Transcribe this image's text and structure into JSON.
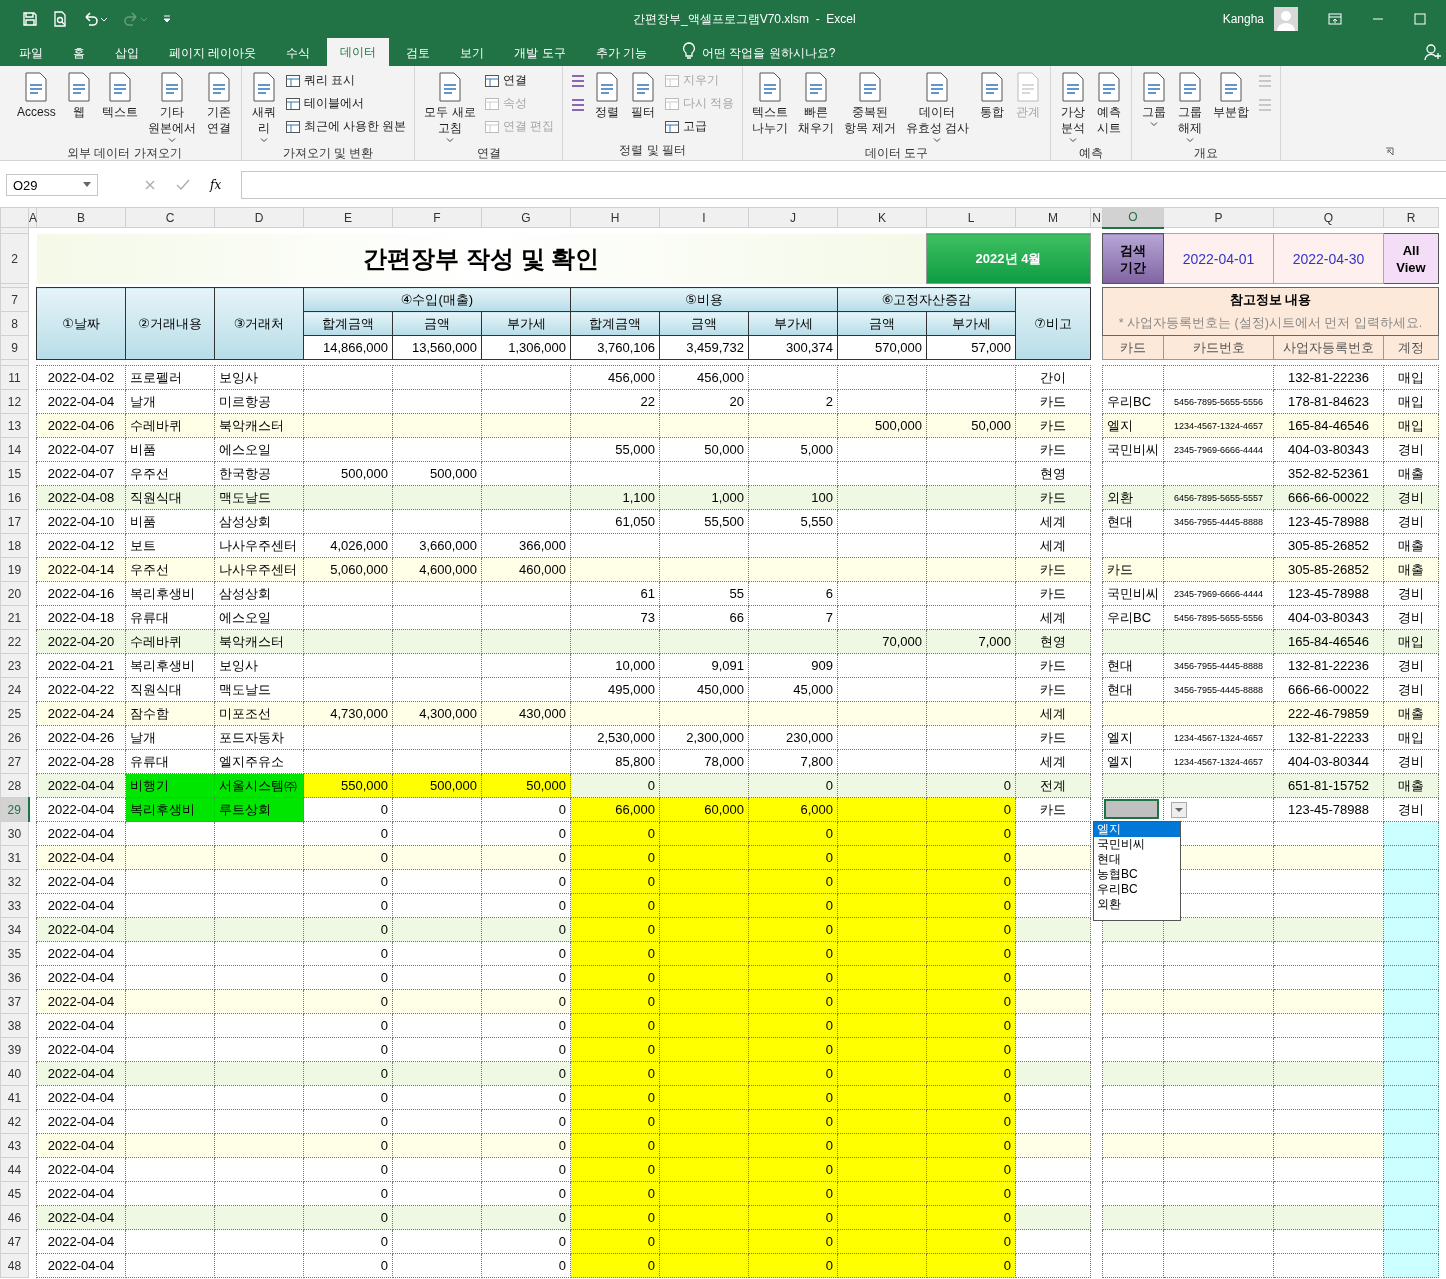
{
  "title_bar": {
    "title": "간편장부_액셀프로그램V70.xlsm  -  Excel",
    "user": "Kangha"
  },
  "tabs": [
    {
      "label": "파일",
      "selected": false
    },
    {
      "label": "홈",
      "selected": false
    },
    {
      "label": "삽입",
      "selected": false
    },
    {
      "label": "페이지 레이아웃",
      "selected": false
    },
    {
      "label": "수식",
      "selected": false
    },
    {
      "label": "데이터",
      "selected": true
    },
    {
      "label": "검토",
      "selected": false
    },
    {
      "label": "보기",
      "selected": false
    },
    {
      "label": "개발 도구",
      "selected": false
    },
    {
      "label": "추가 기능",
      "selected": false
    }
  ],
  "tell_me": {
    "placeholder": "어떤 작업을 원하시나요?"
  },
  "ribbon": [
    {
      "label": "외부 데이터 가져오기",
      "items": [
        {
          "kind": "large",
          "lines": [
            "Access"
          ],
          "menu": false,
          "disabled": false
        },
        {
          "kind": "large",
          "lines": [
            "웹"
          ],
          "menu": false,
          "disabled": false
        },
        {
          "kind": "large",
          "lines": [
            "텍스트"
          ],
          "menu": false,
          "disabled": false
        },
        {
          "kind": "large",
          "lines": [
            "기타",
            "원본에서"
          ],
          "menu": true,
          "disabled": false
        },
        {
          "kind": "large",
          "lines": [
            "기존",
            "연결"
          ],
          "menu": false,
          "disabled": false
        }
      ]
    },
    {
      "label": "가져오기 및 변환",
      "items": [
        {
          "kind": "large",
          "lines": [
            "새쿼",
            "리"
          ],
          "menu": true,
          "disabled": false
        },
        {
          "kind": "stack",
          "items": [
            {
              "label": "쿼리 표시",
              "disabled": false
            },
            {
              "label": "테이블에서",
              "disabled": false
            },
            {
              "label": "최근에 사용한 원본",
              "disabled": false
            }
          ]
        }
      ]
    },
    {
      "label": "연결",
      "items": [
        {
          "kind": "large",
          "lines": [
            "모두 새로",
            "고침"
          ],
          "menu": true,
          "disabled": false
        },
        {
          "kind": "stack",
          "items": [
            {
              "label": "연결",
              "disabled": false
            },
            {
              "label": "속성",
              "disabled": true
            },
            {
              "label": "연결 편집",
              "disabled": true
            }
          ]
        }
      ]
    },
    {
      "label": "정렬 및 필터",
      "items": [
        {
          "kind": "stack",
          "items": [
            {
              "disabled": false
            },
            {
              "disabled": false
            }
          ]
        },
        {
          "kind": "large",
          "lines": [
            "정렬"
          ],
          "menu": false,
          "disabled": false
        },
        {
          "kind": "large",
          "lines": [
            "필터"
          ],
          "menu": false,
          "disabled": false
        },
        {
          "kind": "stack",
          "items": [
            {
              "label": "지우기",
              "disabled": true
            },
            {
              "label": "다시 적용",
              "disabled": true
            },
            {
              "label": "고급",
              "disabled": false
            }
          ]
        }
      ]
    },
    {
      "label": "데이터 도구",
      "items": [
        {
          "kind": "large",
          "lines": [
            "텍스트",
            "나누기"
          ],
          "menu": false,
          "disabled": false
        },
        {
          "kind": "large",
          "lines": [
            "빠른",
            "채우기"
          ],
          "menu": false,
          "disabled": false
        },
        {
          "kind": "large",
          "lines": [
            "중복된",
            "항목 제거"
          ],
          "menu": false,
          "disabled": false
        },
        {
          "kind": "large",
          "lines": [
            "데이터",
            "유효성 검사"
          ],
          "menu": true,
          "disabled": false
        },
        {
          "kind": "large",
          "lines": [
            "통합"
          ],
          "menu": false,
          "disabled": false
        },
        {
          "kind": "large",
          "lines": [
            "관계"
          ],
          "menu": false,
          "disabled": true
        }
      ]
    },
    {
      "label": "예측",
      "items": [
        {
          "kind": "large",
          "lines": [
            "가상",
            "분석"
          ],
          "menu": true,
          "disabled": false
        },
        {
          "kind": "large",
          "lines": [
            "예측",
            "시트"
          ],
          "menu": false,
          "disabled": false
        }
      ]
    },
    {
      "label": "개요",
      "items": [
        {
          "kind": "large",
          "lines": [
            "그룹"
          ],
          "menu": true,
          "disabled": false
        },
        {
          "kind": "large",
          "lines": [
            "그룹",
            "해제"
          ],
          "menu": true,
          "disabled": false
        },
        {
          "kind": "large",
          "lines": [
            "부분합"
          ],
          "menu": false,
          "disabled": false
        },
        {
          "kind": "stack",
          "items": [
            {
              "disabled": true
            },
            {
              "disabled": true
            }
          ]
        }
      ]
    }
  ],
  "formula_bar": {
    "name_box": "O29",
    "fx": "fx"
  },
  "columns": [
    {
      "label": "A",
      "selected": false
    },
    {
      "label": "B",
      "selected": false
    },
    {
      "label": "C",
      "selected": false
    },
    {
      "label": "D",
      "selected": false
    },
    {
      "label": "E",
      "selected": false
    },
    {
      "label": "F",
      "selected": false
    },
    {
      "label": "G",
      "selected": false
    },
    {
      "label": "H",
      "selected": false
    },
    {
      "label": "I",
      "selected": false
    },
    {
      "label": "J",
      "selected": false
    },
    {
      "label": "K",
      "selected": false
    },
    {
      "label": "L",
      "selected": false
    },
    {
      "label": "M",
      "selected": false
    },
    {
      "label": "N",
      "selected": false
    },
    {
      "label": "O",
      "selected": true
    },
    {
      "label": "P",
      "selected": false
    },
    {
      "label": "Q",
      "selected": false
    },
    {
      "label": "R",
      "selected": false
    }
  ],
  "header_rows": [
    "2",
    "7",
    "8",
    "9"
  ],
  "header": {
    "title": "간편장부 작성 및 확인",
    "month": "2022년 4월",
    "search_label": [
      "검색",
      "기간"
    ],
    "start": "2022-04-01",
    "end": "2022-04-30",
    "all_view": [
      "All",
      "View"
    ],
    "col_date": "①날짜",
    "col_desc": "②거래내용",
    "col_vendor": "③거래처",
    "income": {
      "label": "④수입(매출)",
      "sub": [
        "합계금액",
        "금액",
        "부가세"
      ],
      "totals": [
        "14,866,000",
        "13,560,000",
        "1,306,000"
      ]
    },
    "expense": {
      "label": "⑤비용",
      "sub": [
        "합계금액",
        "금액",
        "부가세"
      ],
      "totals": [
        "3,760,106",
        "3,459,732",
        "300,374"
      ]
    },
    "assets": {
      "label": "⑥고정자산증감",
      "sub": [
        "금액",
        "부가세"
      ],
      "totals": [
        "570,000",
        "57,000"
      ]
    },
    "note": "⑦비고",
    "ref_title": "참고정보 내용",
    "ref_note": "* 사업자등록번호는 (설정)시트에서 먼저 입력하세요.",
    "ref_cols": [
      "카드",
      "카드번호",
      "사업자등록번호",
      "계정"
    ]
  },
  "rows": [
    {
      "row": "11",
      "color": "#ffffff",
      "name_fill": false,
      "income_fill": false,
      "expense_fill": false,
      "account_fill": false,
      "selected": false,
      "cells": [
        "2022-04-02",
        "프로펠러",
        "보잉사",
        "",
        "",
        "",
        "456,000",
        "456,000",
        "",
        "",
        "",
        "간이",
        "",
        "",
        "132-81-22236",
        "매입"
      ]
    },
    {
      "row": "12",
      "color": "#ffffff",
      "name_fill": false,
      "income_fill": false,
      "expense_fill": false,
      "account_fill": false,
      "selected": false,
      "cells": [
        "2022-04-04",
        "날개",
        "미르항공",
        "",
        "",
        "",
        "22",
        "20",
        "2",
        "",
        "",
        "카드",
        "우리BC",
        "5456-7895-5655-5556",
        "178-81-84623",
        "매입"
      ]
    },
    {
      "row": "13",
      "color": "#ffffe8",
      "name_fill": false,
      "income_fill": false,
      "expense_fill": false,
      "account_fill": false,
      "selected": false,
      "cells": [
        "2022-04-06",
        "수레바퀴",
        "북악캐스터",
        "",
        "",
        "",
        "",
        "",
        "",
        "500,000",
        "50,000",
        "카드",
        "엘지",
        "1234-4567-1324-4657",
        "165-84-46546",
        "매입"
      ]
    },
    {
      "row": "14",
      "color": "#ffffff",
      "name_fill": false,
      "income_fill": false,
      "expense_fill": false,
      "account_fill": false,
      "selected": false,
      "cells": [
        "2022-04-07",
        "비품",
        "에스오일",
        "",
        "",
        "",
        "55,000",
        "50,000",
        "5,000",
        "",
        "",
        "카드",
        "국민비씨",
        "2345-7969-6666-4444",
        "404-03-80343",
        "경비"
      ]
    },
    {
      "row": "15",
      "color": "#ffffff",
      "name_fill": false,
      "income_fill": false,
      "expense_fill": false,
      "account_fill": false,
      "selected": false,
      "cells": [
        "2022-04-07",
        "우주선",
        "한국항공",
        "500,000",
        "500,000",
        "",
        "",
        "",
        "",
        "",
        "",
        "현영",
        "",
        "",
        "352-82-52361",
        "매출"
      ]
    },
    {
      "row": "16",
      "color": "#eef8e2",
      "name_fill": false,
      "income_fill": false,
      "expense_fill": false,
      "account_fill": false,
      "selected": false,
      "cells": [
        "2022-04-08",
        "직원식대",
        "맥도날드",
        "",
        "",
        "",
        "1,100",
        "1,000",
        "100",
        "",
        "",
        "카드",
        "외환",
        "6456-7895-5655-5557",
        "666-66-00022",
        "경비"
      ]
    },
    {
      "row": "17",
      "color": "#ffffff",
      "name_fill": false,
      "income_fill": false,
      "expense_fill": false,
      "account_fill": false,
      "selected": false,
      "cells": [
        "2022-04-10",
        "비품",
        "삼성상회",
        "",
        "",
        "",
        "61,050",
        "55,500",
        "5,550",
        "",
        "",
        "세계",
        "현대",
        "3456-7955-4445-8888",
        "123-45-78988",
        "경비"
      ]
    },
    {
      "row": "18",
      "color": "#ffffff",
      "name_fill": false,
      "income_fill": false,
      "expense_fill": false,
      "account_fill": false,
      "selected": false,
      "cells": [
        "2022-04-12",
        "보트",
        "나사우주센터",
        "4,026,000",
        "3,660,000",
        "366,000",
        "",
        "",
        "",
        "",
        "",
        "세계",
        "",
        "",
        "305-85-26852",
        "매출"
      ]
    },
    {
      "row": "19",
      "color": "#ffffe8",
      "name_fill": false,
      "income_fill": false,
      "expense_fill": false,
      "account_fill": false,
      "selected": false,
      "cells": [
        "2022-04-14",
        "우주선",
        "나사우주센터",
        "5,060,000",
        "4,600,000",
        "460,000",
        "",
        "",
        "",
        "",
        "",
        "카드",
        "카드",
        "",
        "305-85-26852",
        "매출"
      ]
    },
    {
      "row": "20",
      "color": "#ffffff",
      "name_fill": false,
      "income_fill": false,
      "expense_fill": false,
      "account_fill": false,
      "selected": false,
      "cells": [
        "2022-04-16",
        "복리후생비",
        "삼성상회",
        "",
        "",
        "",
        "61",
        "55",
        "6",
        "",
        "",
        "카드",
        "국민비씨",
        "2345-7969-6666-4444",
        "123-45-78988",
        "경비"
      ]
    },
    {
      "row": "21",
      "color": "#ffffff",
      "name_fill": false,
      "income_fill": false,
      "expense_fill": false,
      "account_fill": false,
      "selected": false,
      "cells": [
        "2022-04-18",
        "유류대",
        "에스오일",
        "",
        "",
        "",
        "73",
        "66",
        "7",
        "",
        "",
        "세계",
        "우리BC",
        "5456-7895-5655-5556",
        "404-03-80343",
        "경비"
      ]
    },
    {
      "row": "22",
      "color": "#eef8e2",
      "name_fill": false,
      "income_fill": false,
      "expense_fill": false,
      "account_fill": false,
      "selected": false,
      "cells": [
        "2022-04-20",
        "수레바퀴",
        "북악캐스터",
        "",
        "",
        "",
        "",
        "",
        "",
        "70,000",
        "7,000",
        "현영",
        "",
        "",
        "165-84-46546",
        "매입"
      ]
    },
    {
      "row": "23",
      "color": "#ffffff",
      "name_fill": false,
      "income_fill": false,
      "expense_fill": false,
      "account_fill": false,
      "selected": false,
      "cells": [
        "2022-04-21",
        "복리후생비",
        "보잉사",
        "",
        "",
        "",
        "10,000",
        "9,091",
        "909",
        "",
        "",
        "카드",
        "현대",
        "3456-7955-4445-8888",
        "132-81-22236",
        "경비"
      ]
    },
    {
      "row": "24",
      "color": "#ffffff",
      "name_fill": false,
      "income_fill": false,
      "expense_fill": false,
      "account_fill": false,
      "selected": false,
      "cells": [
        "2022-04-22",
        "직원식대",
        "맥도날드",
        "",
        "",
        "",
        "495,000",
        "450,000",
        "45,000",
        "",
        "",
        "카드",
        "현대",
        "3456-7955-4445-8888",
        "666-66-00022",
        "경비"
      ]
    },
    {
      "row": "25",
      "color": "#ffffe8",
      "name_fill": false,
      "income_fill": false,
      "expense_fill": false,
      "account_fill": false,
      "selected": false,
      "cells": [
        "2022-04-24",
        "잠수함",
        "미포조선",
        "4,730,000",
        "4,300,000",
        "430,000",
        "",
        "",
        "",
        "",
        "",
        "세계",
        "",
        "",
        "222-46-79859",
        "매출"
      ]
    },
    {
      "row": "26",
      "color": "#ffffff",
      "name_fill": false,
      "income_fill": false,
      "expense_fill": false,
      "account_fill": false,
      "selected": false,
      "cells": [
        "2022-04-26",
        "날개",
        "포드자동차",
        "",
        "",
        "",
        "2,530,000",
        "2,300,000",
        "230,000",
        "",
        "",
        "카드",
        "엘지",
        "1234-4567-1324-4657",
        "132-81-22233",
        "매입"
      ]
    },
    {
      "row": "27",
      "color": "#ffffff",
      "name_fill": false,
      "income_fill": false,
      "expense_fill": false,
      "account_fill": false,
      "selected": false,
      "cells": [
        "2022-04-28",
        "유류대",
        "엘지주유소",
        "",
        "",
        "",
        "85,800",
        "78,000",
        "7,800",
        "",
        "",
        "세계",
        "엘지",
        "1234-4567-1324-4657",
        "404-03-80344",
        "경비"
      ]
    },
    {
      "row": "28",
      "color": "#eef8e2",
      "name_fill": true,
      "income_fill": true,
      "expense_fill": false,
      "account_fill": false,
      "selected": false,
      "cells": [
        "2022-04-04",
        "비행기",
        "서울시스템㈜",
        "550,000",
        "500,000",
        "50,000",
        "0",
        "",
        "0",
        "",
        "0",
        "전계",
        "",
        "",
        "651-81-15752",
        "매출"
      ]
    },
    {
      "row": "29",
      "color": "#ffffff",
      "name_fill": true,
      "income_fill": false,
      "expense_fill": true,
      "account_fill": false,
      "selected": true,
      "cells": [
        "2022-04-04",
        "복리후생비",
        "루트상회",
        "0",
        "",
        "0",
        "66,000",
        "60,000",
        "6,000",
        "",
        "0",
        "카드",
        "",
        "",
        "123-45-78988",
        "경비"
      ]
    },
    {
      "row": "30",
      "color": "#ffffff",
      "name_fill": false,
      "income_fill": false,
      "expense_fill": true,
      "account_fill": true,
      "selected": false,
      "cells": [
        "2022-04-04",
        "",
        "",
        "0",
        "",
        "0",
        "0",
        "",
        "0",
        "",
        "0",
        "",
        "",
        "",
        "",
        ""
      ]
    },
    {
      "row": "31",
      "color": "#ffffe8",
      "name_fill": false,
      "income_fill": false,
      "expense_fill": true,
      "account_fill": true,
      "selected": false,
      "cells": [
        "2022-04-04",
        "",
        "",
        "0",
        "",
        "0",
        "0",
        "",
        "0",
        "",
        "0",
        "",
        "",
        "",
        "",
        ""
      ]
    },
    {
      "row": "32",
      "color": "#ffffff",
      "name_fill": false,
      "income_fill": false,
      "expense_fill": true,
      "account_fill": true,
      "selected": false,
      "cells": [
        "2022-04-04",
        "",
        "",
        "0",
        "",
        "0",
        "0",
        "",
        "0",
        "",
        "0",
        "",
        "",
        "",
        "",
        ""
      ]
    },
    {
      "row": "33",
      "color": "#ffffff",
      "name_fill": false,
      "income_fill": false,
      "expense_fill": true,
      "account_fill": true,
      "selected": false,
      "cells": [
        "2022-04-04",
        "",
        "",
        "0",
        "",
        "0",
        "0",
        "",
        "0",
        "",
        "0",
        "",
        "",
        "",
        "",
        ""
      ]
    },
    {
      "row": "34",
      "color": "#eef8e2",
      "name_fill": false,
      "income_fill": false,
      "expense_fill": true,
      "account_fill": true,
      "selected": false,
      "cells": [
        "2022-04-04",
        "",
        "",
        "0",
        "",
        "0",
        "0",
        "",
        "0",
        "",
        "0",
        "",
        "",
        "",
        "",
        ""
      ]
    },
    {
      "row": "35",
      "color": "#ffffff",
      "name_fill": false,
      "income_fill": false,
      "expense_fill": true,
      "account_fill": true,
      "selected": false,
      "cells": [
        "2022-04-04",
        "",
        "",
        "0",
        "",
        "0",
        "0",
        "",
        "0",
        "",
        "0",
        "",
        "",
        "",
        "",
        ""
      ]
    },
    {
      "row": "36",
      "color": "#ffffff",
      "name_fill": false,
      "income_fill": false,
      "expense_fill": true,
      "account_fill": true,
      "selected": false,
      "cells": [
        "2022-04-04",
        "",
        "",
        "0",
        "",
        "0",
        "0",
        "",
        "0",
        "",
        "0",
        "",
        "",
        "",
        "",
        ""
      ]
    },
    {
      "row": "37",
      "color": "#ffffe8",
      "name_fill": false,
      "income_fill": false,
      "expense_fill": true,
      "account_fill": true,
      "selected": false,
      "cells": [
        "2022-04-04",
        "",
        "",
        "0",
        "",
        "0",
        "0",
        "",
        "0",
        "",
        "0",
        "",
        "",
        "",
        "",
        ""
      ]
    },
    {
      "row": "38",
      "color": "#ffffff",
      "name_fill": false,
      "income_fill": false,
      "expense_fill": true,
      "account_fill": true,
      "selected": false,
      "cells": [
        "2022-04-04",
        "",
        "",
        "0",
        "",
        "0",
        "0",
        "",
        "0",
        "",
        "0",
        "",
        "",
        "",
        "",
        ""
      ]
    },
    {
      "row": "39",
      "color": "#ffffff",
      "name_fill": false,
      "income_fill": false,
      "expense_fill": true,
      "account_fill": true,
      "selected": false,
      "cells": [
        "2022-04-04",
        "",
        "",
        "0",
        "",
        "0",
        "0",
        "",
        "0",
        "",
        "0",
        "",
        "",
        "",
        "",
        ""
      ]
    },
    {
      "row": "40",
      "color": "#eef8e2",
      "name_fill": false,
      "income_fill": false,
      "expense_fill": true,
      "account_fill": true,
      "selected": false,
      "cells": [
        "2022-04-04",
        "",
        "",
        "0",
        "",
        "0",
        "0",
        "",
        "0",
        "",
        "0",
        "",
        "",
        "",
        "",
        ""
      ]
    },
    {
      "row": "41",
      "color": "#ffffff",
      "name_fill": false,
      "income_fill": false,
      "expense_fill": true,
      "account_fill": true,
      "selected": false,
      "cells": [
        "2022-04-04",
        "",
        "",
        "0",
        "",
        "0",
        "0",
        "",
        "0",
        "",
        "0",
        "",
        "",
        "",
        "",
        ""
      ]
    },
    {
      "row": "42",
      "color": "#ffffff",
      "name_fill": false,
      "income_fill": false,
      "expense_fill": true,
      "account_fill": true,
      "selected": false,
      "cells": [
        "2022-04-04",
        "",
        "",
        "0",
        "",
        "0",
        "0",
        "",
        "0",
        "",
        "0",
        "",
        "",
        "",
        "",
        ""
      ]
    },
    {
      "row": "43",
      "color": "#ffffe8",
      "name_fill": false,
      "income_fill": false,
      "expense_fill": true,
      "account_fill": true,
      "selected": false,
      "cells": [
        "2022-04-04",
        "",
        "",
        "0",
        "",
        "0",
        "0",
        "",
        "0",
        "",
        "0",
        "",
        "",
        "",
        "",
        ""
      ]
    },
    {
      "row": "44",
      "color": "#ffffff",
      "name_fill": false,
      "income_fill": false,
      "expense_fill": true,
      "account_fill": true,
      "selected": false,
      "cells": [
        "2022-04-04",
        "",
        "",
        "0",
        "",
        "0",
        "0",
        "",
        "0",
        "",
        "0",
        "",
        "",
        "",
        "",
        ""
      ]
    },
    {
      "row": "45",
      "color": "#ffffff",
      "name_fill": false,
      "income_fill": false,
      "expense_fill": true,
      "account_fill": true,
      "selected": false,
      "cells": [
        "2022-04-04",
        "",
        "",
        "0",
        "",
        "0",
        "0",
        "",
        "0",
        "",
        "0",
        "",
        "",
        "",
        "",
        ""
      ]
    },
    {
      "row": "46",
      "color": "#eef8e2",
      "name_fill": false,
      "income_fill": false,
      "expense_fill": true,
      "account_fill": true,
      "selected": false,
      "cells": [
        "2022-04-04",
        "",
        "",
        "0",
        "",
        "0",
        "0",
        "",
        "0",
        "",
        "0",
        "",
        "",
        "",
        "",
        ""
      ]
    },
    {
      "row": "47",
      "color": "#ffffff",
      "name_fill": false,
      "income_fill": false,
      "expense_fill": true,
      "account_fill": true,
      "selected": false,
      "cells": [
        "2022-04-04",
        "",
        "",
        "0",
        "",
        "0",
        "0",
        "",
        "0",
        "",
        "0",
        "",
        "",
        "",
        "",
        ""
      ]
    },
    {
      "row": "48",
      "color": "#ffffff",
      "name_fill": false,
      "income_fill": false,
      "expense_fill": true,
      "account_fill": true,
      "selected": false,
      "cells": [
        "2022-04-04",
        "",
        "",
        "0",
        "",
        "0",
        "0",
        "",
        "0",
        "",
        "0",
        "",
        "",
        "",
        "",
        ""
      ]
    }
  ],
  "dropdown": {
    "items": [
      {
        "label": "엘지",
        "selected": true
      },
      {
        "label": "국민비씨",
        "selected": false
      },
      {
        "label": "현대",
        "selected": false
      },
      {
        "label": "농협BC",
        "selected": false
      },
      {
        "label": "우리BC",
        "selected": false
      },
      {
        "label": "외환",
        "selected": false
      }
    ]
  }
}
